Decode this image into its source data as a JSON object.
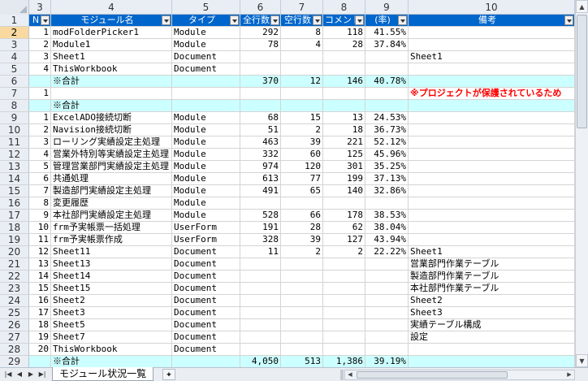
{
  "columns": [
    "3",
    "4",
    "5",
    "6",
    "7",
    "8",
    "9",
    "10"
  ],
  "header_row": {
    "row_num": "1",
    "cells": [
      "N",
      "モジュール名",
      "タイプ",
      "全行数",
      "空行数",
      "コメント",
      "(率)",
      "備考"
    ]
  },
  "rows": [
    {
      "n": "2",
      "c": [
        "1",
        "modFolderPicker1",
        "Module",
        "292",
        "8",
        "118",
        "41.55%",
        ""
      ],
      "selected": true
    },
    {
      "n": "3",
      "c": [
        "2",
        "Module1",
        "Module",
        "78",
        "4",
        "28",
        "37.84%",
        ""
      ]
    },
    {
      "n": "4",
      "c": [
        "3",
        "Sheet1",
        "Document",
        "",
        "",
        "",
        "",
        "Sheet1"
      ]
    },
    {
      "n": "5",
      "c": [
        "4",
        "ThisWorkbook",
        "Document",
        "",
        "",
        "",
        "",
        ""
      ]
    },
    {
      "n": "6",
      "c": [
        "",
        "※合計",
        "",
        "370",
        "12",
        "146",
        "40.78%",
        ""
      ],
      "sum": true
    },
    {
      "n": "7",
      "c": [
        "1",
        "",
        "",
        "",
        "",
        "",
        "",
        "※プロジェクトが保護されているため"
      ],
      "warn": true
    },
    {
      "n": "8",
      "c": [
        "",
        "※合計",
        "",
        "",
        "",
        "",
        "",
        ""
      ],
      "sum": true
    },
    {
      "n": "9",
      "c": [
        "1",
        "ExcelADO接続切断",
        "Module",
        "68",
        "15",
        "13",
        "24.53%",
        ""
      ]
    },
    {
      "n": "10",
      "c": [
        "2",
        "Navision接続切断",
        "Module",
        "51",
        "2",
        "18",
        "36.73%",
        ""
      ]
    },
    {
      "n": "11",
      "c": [
        "3",
        "ローリング実績設定主処理",
        "Module",
        "463",
        "39",
        "221",
        "52.12%",
        ""
      ]
    },
    {
      "n": "12",
      "c": [
        "4",
        "営業外特別等実績設定主処理",
        "Module",
        "332",
        "60",
        "125",
        "45.96%",
        ""
      ]
    },
    {
      "n": "13",
      "c": [
        "5",
        "管理営業部門実績設定主処理",
        "Module",
        "974",
        "120",
        "301",
        "35.25%",
        ""
      ]
    },
    {
      "n": "14",
      "c": [
        "6",
        "共通処理",
        "Module",
        "613",
        "77",
        "199",
        "37.13%",
        ""
      ]
    },
    {
      "n": "15",
      "c": [
        "7",
        "製造部門実績設定主処理",
        "Module",
        "491",
        "65",
        "140",
        "32.86%",
        ""
      ]
    },
    {
      "n": "16",
      "c": [
        "8",
        "変更履歴",
        "Module",
        "",
        "",
        "",
        "",
        ""
      ]
    },
    {
      "n": "17",
      "c": [
        "9",
        "本社部門実績設定主処理",
        "Module",
        "528",
        "66",
        "178",
        "38.53%",
        ""
      ]
    },
    {
      "n": "18",
      "c": [
        "10",
        "frm予実帳票一括処理",
        "UserForm",
        "191",
        "28",
        "62",
        "38.04%",
        ""
      ]
    },
    {
      "n": "19",
      "c": [
        "11",
        "frm予実帳票作成",
        "UserForm",
        "328",
        "39",
        "127",
        "43.94%",
        ""
      ]
    },
    {
      "n": "20",
      "c": [
        "12",
        "Sheet11",
        "Document",
        "11",
        "2",
        "2",
        "22.22%",
        "Sheet1"
      ]
    },
    {
      "n": "21",
      "c": [
        "13",
        "Sheet13",
        "Document",
        "",
        "",
        "",
        "",
        "営業部門作業テーブル"
      ]
    },
    {
      "n": "22",
      "c": [
        "14",
        "Sheet14",
        "Document",
        "",
        "",
        "",
        "",
        "製造部門作業テーブル"
      ]
    },
    {
      "n": "23",
      "c": [
        "15",
        "Sheet15",
        "Document",
        "",
        "",
        "",
        "",
        "本社部門作業テーブル"
      ]
    },
    {
      "n": "24",
      "c": [
        "16",
        "Sheet2",
        "Document",
        "",
        "",
        "",
        "",
        "Sheet2"
      ]
    },
    {
      "n": "25",
      "c": [
        "17",
        "Sheet3",
        "Document",
        "",
        "",
        "",
        "",
        "Sheet3"
      ]
    },
    {
      "n": "26",
      "c": [
        "18",
        "Sheet5",
        "Document",
        "",
        "",
        "",
        "",
        "実績テーブル構成"
      ]
    },
    {
      "n": "27",
      "c": [
        "19",
        "Sheet7",
        "Document",
        "",
        "",
        "",
        "",
        "設定"
      ]
    },
    {
      "n": "28",
      "c": [
        "20",
        "ThisWorkbook",
        "Document",
        "",
        "",
        "",
        "",
        ""
      ]
    },
    {
      "n": "29",
      "c": [
        "",
        "※合計",
        "",
        "4,050",
        "513",
        "1,386",
        "39.19%",
        ""
      ],
      "sum": true
    }
  ],
  "sheet_tab": "モジュール状況一覧",
  "nav_icons": [
    "first-sheet-icon",
    "prev-sheet-icon",
    "next-sheet-icon",
    "last-sheet-icon"
  ],
  "colors": {
    "header_bg": "#0066cc",
    "sum_bg": "#ccffff",
    "warn_text": "#ff0000",
    "selected_row_header": "#f9d99f"
  }
}
